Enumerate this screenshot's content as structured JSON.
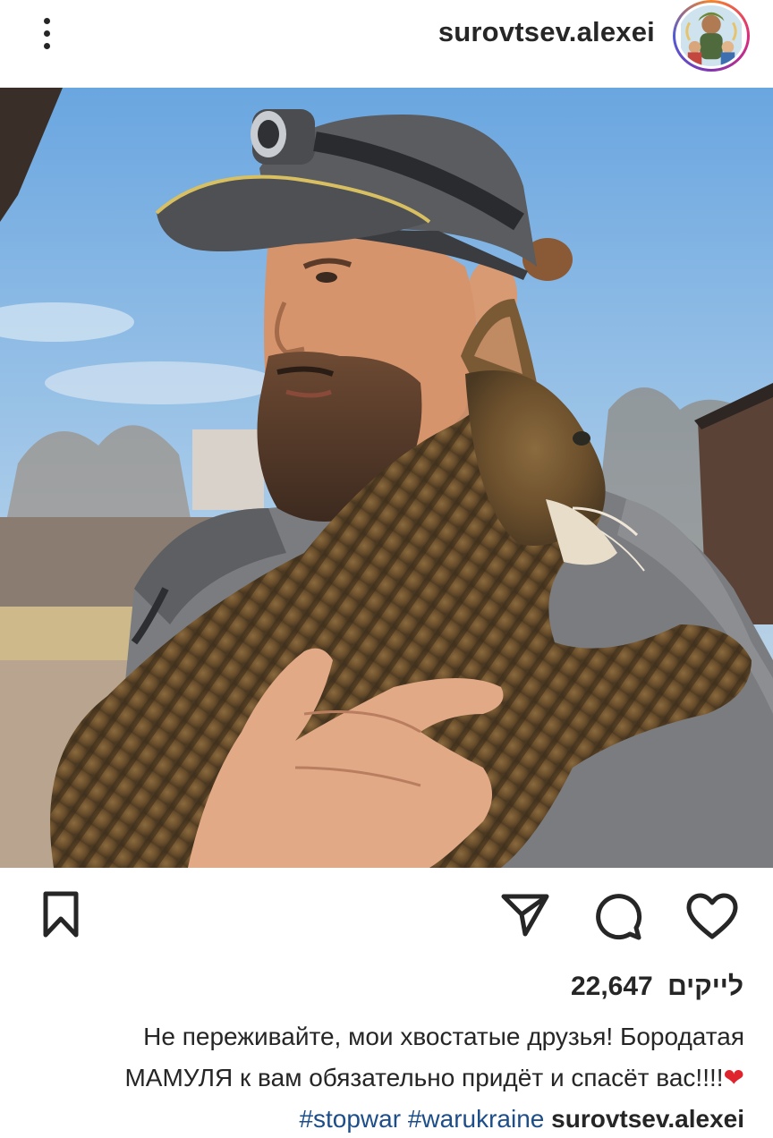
{
  "header": {
    "more_icon": "vertical-ellipsis-icon",
    "username": "surovtsev.alexei"
  },
  "actions": {
    "save_icon": "bookmark-icon",
    "share_icon": "send-icon",
    "comment_icon": "comment-icon",
    "like_icon": "heart-icon"
  },
  "likes": {
    "count": "22,647",
    "label": "לייקים"
  },
  "caption": {
    "username": "surovtsev.alexei",
    "text": "Не переживайте, мои хвостатые друзья! Бородатая МАМУЛЯ к вам обязательно придёт и спасёт вас!!!!",
    "emoji": "❤",
    "hashtags": [
      "#stopwar",
      "#warukraine"
    ]
  },
  "colors": {
    "text": "#262626",
    "hashtag": "#1d4e89",
    "sky": "#7fb4e6",
    "heart_emoji": "#e0242e"
  }
}
